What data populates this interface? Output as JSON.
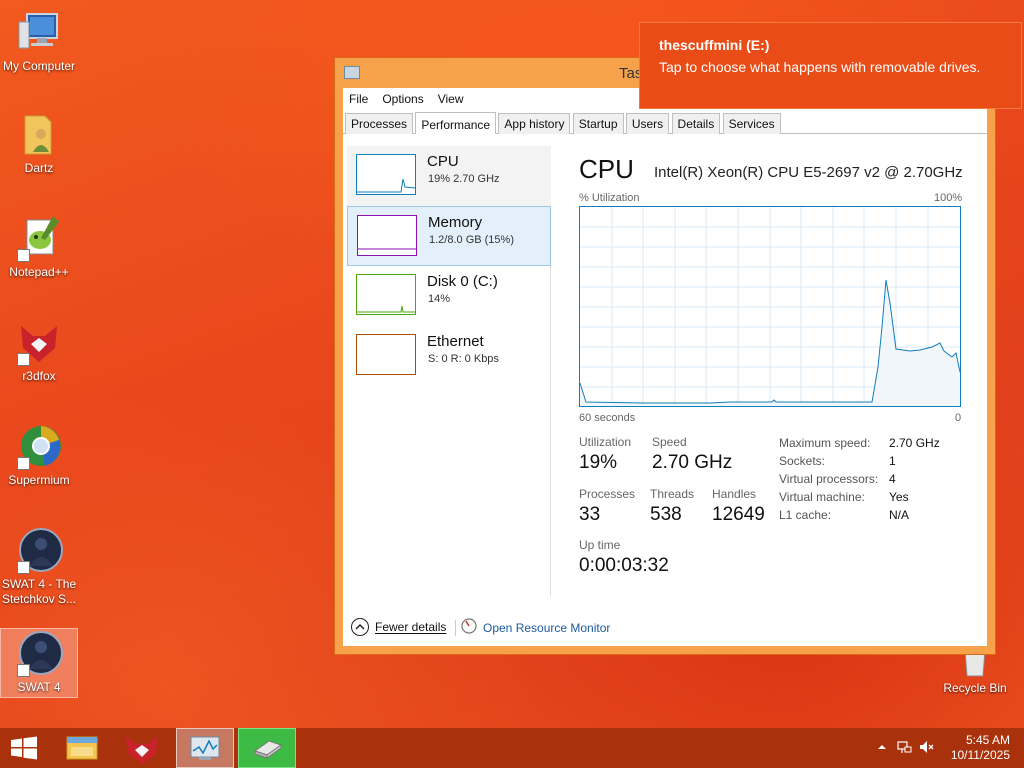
{
  "desktop_icons": [
    {
      "label": "My Computer",
      "icon": "computer-icon"
    },
    {
      "label": "Dartz",
      "icon": "folder-user-icon"
    },
    {
      "label": "Notepad++",
      "icon": "notepad-plus-plus-icon"
    },
    {
      "label": "r3dfox",
      "icon": "r3dfox-icon"
    },
    {
      "label": "Supermium",
      "icon": "supermium-icon"
    },
    {
      "label": "SWAT 4 - The Stetchkov S...",
      "icon": "swat4-icon"
    },
    {
      "label": "SWAT 4",
      "icon": "swat4-icon"
    },
    {
      "label": "Recycle Bin",
      "icon": "recycle-bin-icon"
    }
  ],
  "toast": {
    "title": "thescuffmini (E:)",
    "message": "Tap to choose what happens with removable drives."
  },
  "window": {
    "title": "Tas",
    "menu": [
      "File",
      "Options",
      "View"
    ],
    "tabs": [
      "Processes",
      "Performance",
      "App history",
      "Startup",
      "Users",
      "Details",
      "Services"
    ],
    "active_tab": "Performance"
  },
  "sidebar": {
    "items": [
      {
        "name": "CPU",
        "value": "19% 2.70 GHz",
        "color": "#117dbb"
      },
      {
        "name": "Memory",
        "value": "1.2/8.0 GB (15%)",
        "color": "#8b12ae"
      },
      {
        "name": "Disk 0 (C:)",
        "value": "14%",
        "color": "#4da60c"
      },
      {
        "name": "Ethernet",
        "value": "S: 0 R: 0 Kbps",
        "color": "#a74f01"
      }
    ]
  },
  "detail": {
    "title": "CPU",
    "model": "Intel(R) Xeon(R) CPU E5-2697 v2 @ 2.70GHz",
    "y_label": "% Utilization",
    "y_max_label": "100%",
    "x_left_label": "60 seconds",
    "x_right_label": "0",
    "stats": {
      "utilization_label": "Utilization",
      "utilization": "19%",
      "speed_label": "Speed",
      "speed": "2.70 GHz",
      "processes_label": "Processes",
      "processes": "33",
      "threads_label": "Threads",
      "threads": "538",
      "handles_label": "Handles",
      "handles": "12649",
      "uptime_label": "Up time",
      "uptime": "0:00:03:32"
    },
    "specs": [
      {
        "key": "Maximum speed:",
        "value": "2.70 GHz"
      },
      {
        "key": "Sockets:",
        "value": "1"
      },
      {
        "key": "Virtual processors:",
        "value": "4"
      },
      {
        "key": "Virtual machine:",
        "value": "Yes"
      },
      {
        "key": "L1 cache:",
        "value": "N/A"
      }
    ]
  },
  "footer": {
    "fewer_details": "Fewer details",
    "resource_monitor": "Open Resource Monitor"
  },
  "taskbar": {
    "time": "5:45 AM",
    "date": "10/11/2025"
  },
  "colors": {
    "accent_cpu": "#117dbb",
    "toast_bg": "#e94c16",
    "taskbar_bg": "#a9310c"
  }
}
